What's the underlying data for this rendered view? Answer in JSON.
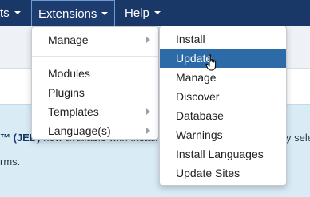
{
  "navbar": {
    "items": [
      {
        "label": "ts"
      },
      {
        "label": "Extensions"
      },
      {
        "label": "Help"
      }
    ]
  },
  "page": {
    "info_line1_bold": "™ (JED)",
    "info_line1_rest": "now available with Install",
    "info_line1_tail": "y sele",
    "info_line2": "rms."
  },
  "extensions_menu": {
    "items": [
      {
        "label": "Manage"
      },
      {
        "label": "Modules"
      },
      {
        "label": "Plugins"
      },
      {
        "label": "Templates"
      },
      {
        "label": "Language(s)"
      }
    ]
  },
  "manage_submenu": {
    "items": [
      {
        "label": "Install"
      },
      {
        "label": "Update"
      },
      {
        "label": "Manage"
      },
      {
        "label": "Discover"
      },
      {
        "label": "Database"
      },
      {
        "label": "Warnings"
      },
      {
        "label": "Install Languages"
      },
      {
        "label": "Update Sites"
      }
    ]
  },
  "icons": {
    "caret": "caret-down-icon",
    "submenu_arrow": "chevron-right-icon",
    "cursor": "hand-pointer-icon"
  },
  "colors": {
    "navbar": "#1a3867",
    "highlight": "#2c6aa8",
    "info_panel": "#d9ecf6"
  }
}
